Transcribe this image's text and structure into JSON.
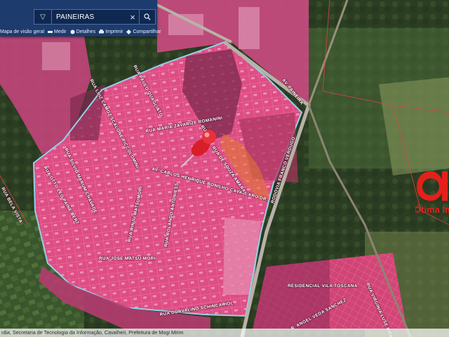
{
  "toolbar": {
    "search_value": "PAINEIRAS",
    "tools": [
      {
        "label": "Mapa de visão geral",
        "icon": "grid-icon"
      },
      {
        "label": "Medir",
        "icon": "ruler-icon"
      },
      {
        "label": "Detalhes",
        "icon": "info-icon"
      },
      {
        "label": "Imprimir",
        "icon": "printer-icon"
      },
      {
        "label": "Compartilhar",
        "icon": "share-icon"
      }
    ]
  },
  "map": {
    "streets": {
      "rua_maria_zavarize_romanini": "RUA MARIA ZAVARIZE ROMANINI",
      "av_carlos_henrique": "AV. CARLOS HENRIQUE BONILHO CAVALLARO DR.",
      "rua_jose_matsu_mori": "RUA JOSE MATSU MORI",
      "rua_durvalino_schincariol": "RUA DURVALINO SCHINCARIOL",
      "rua_rinju_matsumori": "RUA RINJU MATSUMORI",
      "rua_rolando_antoniess": "RUA ROLANDO ANTONIESS",
      "rua_silvio_marum_chavade": "RUA SILVIO MARUM CHAVADE",
      "rua_luiz_antonio_piccolomini": "RUA LUIZ CAMOZ SCALONE PICCOLOMINI",
      "rua_paulo_quagliato": "RUA PAULO QUAGLIATO",
      "rua_otto_leo": "RUA OTTO LEO PAINE BERT",
      "rua_bela_vista": "RUA BELA VISTA",
      "av_paineira": "AV. PAINEIRA",
      "rua_de_souza_amaral": "RUA DE SOUZA AMARAL",
      "rua_j": "RUA",
      "rodovia_francisco_verdugo": "RODOVIA FRANCO VERDUGO",
      "residencial_vila_toscana": "RESIDENCIAL VILA TOSCANA",
      "rua_angela_veda_sanchez": "R. ANGEL VEDA SANCHEZ",
      "rua_vinicius": "RUA VIRGINIA LUSE RICHA"
    },
    "pin_icon": "pushpin-icon",
    "colors": {
      "parcel_fill": "#e0457a",
      "boundary": "#8fd3e8",
      "pin": "#e0222c"
    }
  },
  "logo": {
    "text": "Ótima Im",
    "color": "#e4201b"
  },
  "attribution": "rdia, Secretaria de Tecnologia da Informação, Cavalheri, Prefeitura de Mogi Mirim"
}
